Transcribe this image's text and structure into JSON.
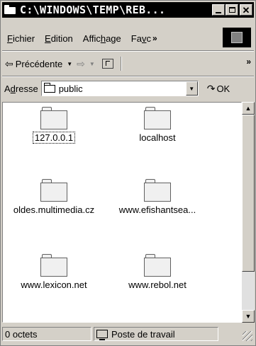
{
  "window": {
    "title": "C:\\WINDOWS\\TEMP\\REB..."
  },
  "title_buttons": {
    "close": "✕"
  },
  "menu": {
    "items": [
      {
        "pre": "",
        "u": "F",
        "post": "ichier"
      },
      {
        "pre": "",
        "u": "E",
        "post": "dition"
      },
      {
        "pre": "Affic",
        "u": "h",
        "post": "age"
      },
      {
        "pre": "Fa",
        "u": "v",
        "post": "c"
      }
    ],
    "overflow": "»"
  },
  "toolbar": {
    "back_arrow": "⇦",
    "back_label": "Précédente",
    "dropdown": "▼",
    "forward_arrow": "⇨",
    "overflow": "»"
  },
  "address": {
    "label_pre": "A",
    "label_u": "d",
    "label_post": "resse",
    "value": "public",
    "go_icon": "↷",
    "go_label": "OK"
  },
  "files": [
    {
      "name": "127.0.0.1"
    },
    {
      "name": "localhost"
    },
    {
      "name": "oldes.multimedia.cz"
    },
    {
      "name": "www.efishantsea..."
    },
    {
      "name": "www.lexicon.net"
    },
    {
      "name": "www.rebol.net"
    }
  ],
  "scrollbar": {
    "up": "▲",
    "down": "▼"
  },
  "status": {
    "size": "0 octets",
    "zone": "Poste de travail"
  }
}
